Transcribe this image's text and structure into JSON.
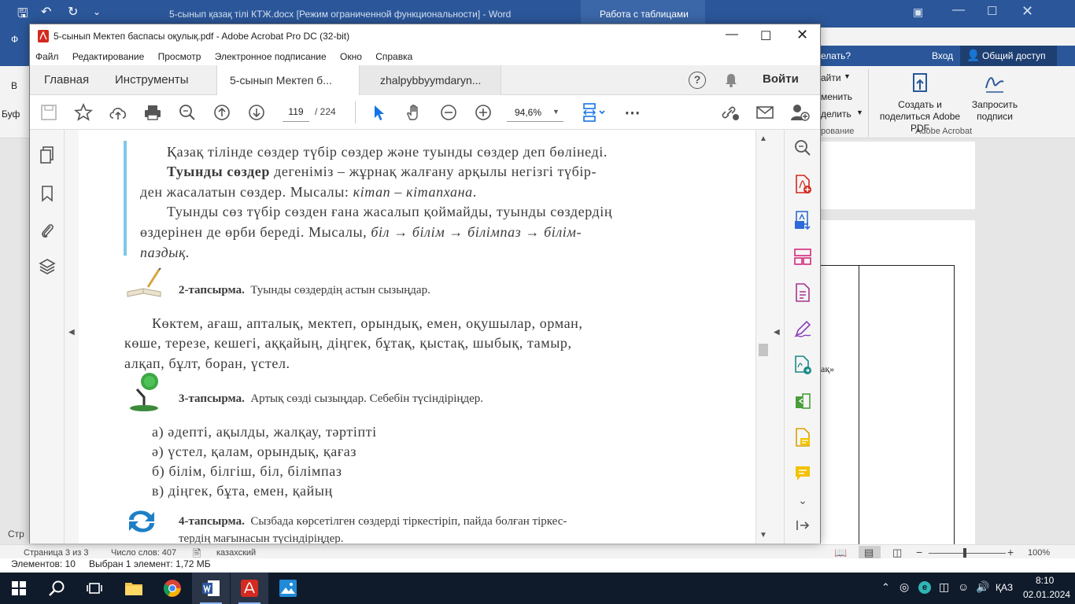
{
  "word": {
    "title": "5-сынып қазақ тілі КТЖ.docx [Режим ограниченной функциональности] - Word",
    "table_tools": "Работа с таблицами",
    "qat_letter": "Ф",
    "ask": "елать?",
    "login": "Вход",
    "share": "Общий доступ",
    "rib_partial1": "айти",
    "rib_partial2": "менить",
    "rib_partial3": "делить",
    "rib_partial4": "рование",
    "create_pdf": "Создать и поделиться Adobe PDF",
    "request_sign": "Запросить подписи",
    "adobe_group": "Adobe Acrobat",
    "left_b": "В",
    "left_buf": "Буф",
    "left_str": "Стр",
    "doc_frag": "ақ»",
    "status_page": "Страница 3 из 3",
    "status_words": "Число слов: 407",
    "status_lang": "казахский",
    "zoom": "100%",
    "explorer_items": "Элементов: 10",
    "explorer_sel": "Выбран 1 элемент: 1,72 МБ"
  },
  "acrobat": {
    "title": "5-сынып Мектеп баспасы оқулық.pdf - Adobe Acrobat Pro DC (32-bit)",
    "menu": [
      "Файл",
      "Редактирование",
      "Просмотр",
      "Электронное подписание",
      "Окно",
      "Справка"
    ],
    "tabs": {
      "home": "Главная",
      "tools": "Инструменты",
      "doc1": "5-сынып Мектеп б...",
      "doc2": "zhalpybbyymdaryn..."
    },
    "login": "Войти",
    "page_current": "119",
    "page_total": "/ 224",
    "zoom": "94,6%"
  },
  "page": {
    "p1": "Қазақ тілінде сөздер түбір сөздер және туынды сөздер деп бөлінеді.",
    "p2_bold": "Туынды сөздер",
    "p2_rest": " дегеніміз – жұрнақ жалғану арқылы негізгі түбір-",
    "p3a": "ден жасалатын сөздер. Мысалы: ",
    "p3b": "кітап – кітапхана",
    "p3c": ".",
    "p4": "Туынды сөз түбір сөзден ғана жасалып қоймайды, туынды сөздердің",
    "p5a": "өздерінен де өрби береді. Мысалы, ",
    "p5b": "біл → білім → білімпаз → білім-",
    "p6": "паздық.",
    "task2_label": "2-тапсырма.",
    "task2_text": "Туынды сөздердің астын сызыңдар.",
    "w1": "Көктем, ағаш, апталық, мектеп, орындық, емен, оқушылар, орман,",
    "w2": "көше, терезе, кешегі, аққайың, діңгек, бұтақ, қыстақ, шыбық, тамыр,",
    "w3": "алқап, бұлт, боран, үстел.",
    "task3_label": "3-тапсырма.",
    "task3_text": "Артық сөзді сызыңдар. Себебін түсіндіріңдер.",
    "a": "а) әдепті, ақылды, жалқау, тәртіпті",
    "ae": "ә) үстел, қалам, орындық, қағаз",
    "b": "б) білім, білгіш, біл, білімпаз",
    "v": "в) діңгек, бұта, емен, қайың",
    "task4_label": "4-тапсырма.",
    "task4_text": "Сызбада көрсетілген сөздерді тіркестіріп, пайда болған тіркес-",
    "task4_line2": "тердің мағынасын түсіндіріңдер."
  },
  "taskbar": {
    "lang": "ҚАЗ",
    "time": "8:10",
    "date": "02.01.2024"
  },
  "colors": {
    "word_blue": "#2b579a",
    "acrobat_red": "#d42a1f",
    "acrobat_tool": "#5a5a5a",
    "taskbar": "#0f1a2b"
  }
}
